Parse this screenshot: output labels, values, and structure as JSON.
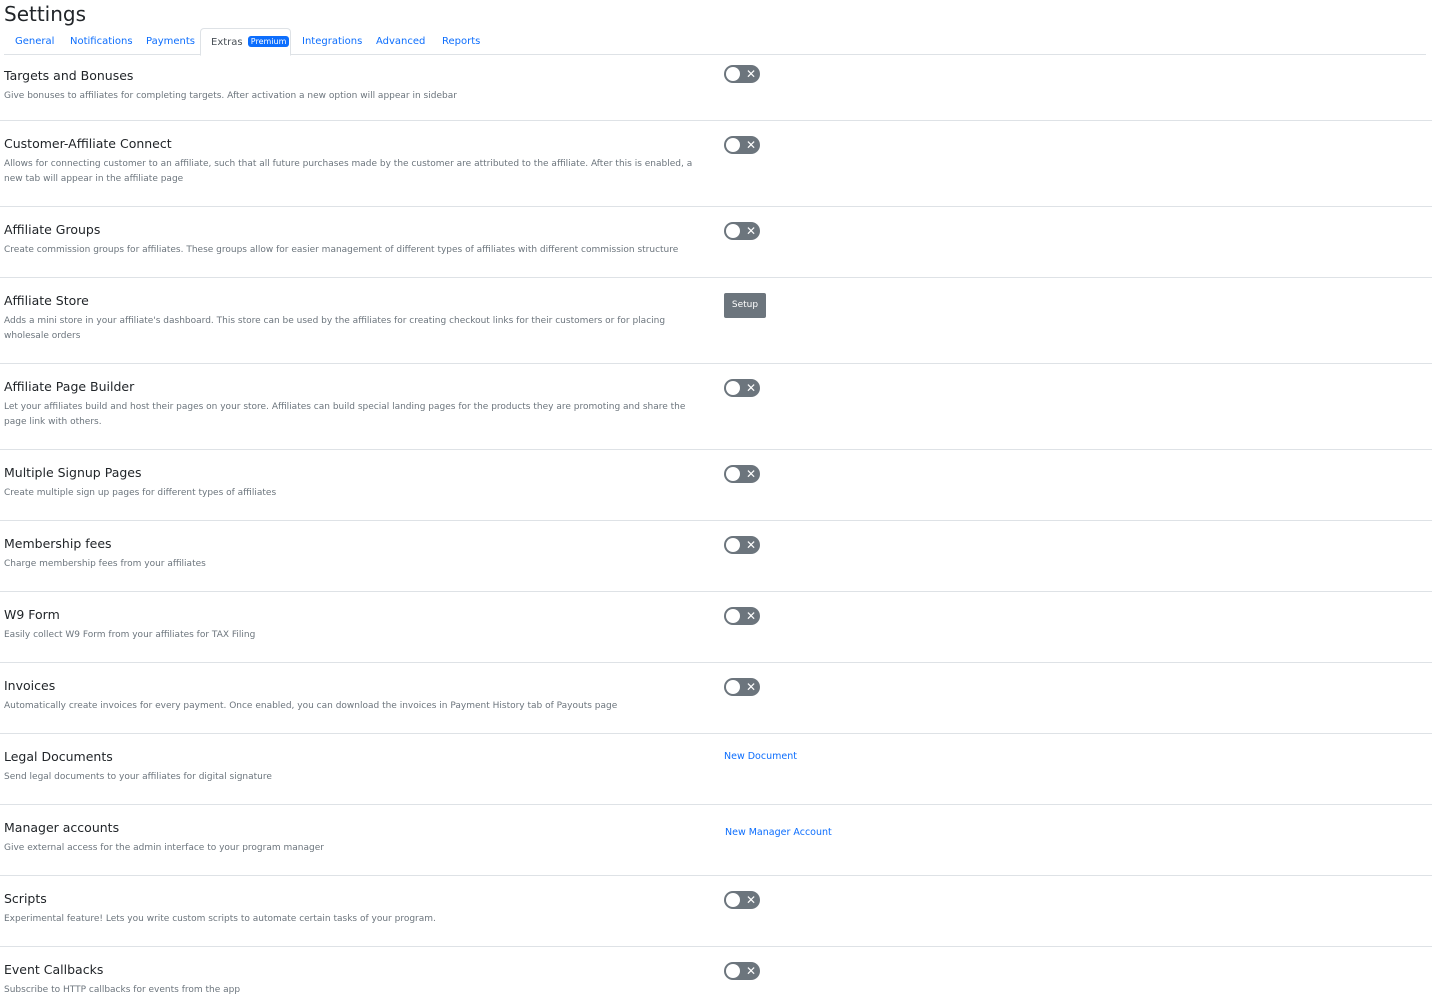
{
  "page": {
    "title": "Settings"
  },
  "tabs": [
    {
      "label": "General"
    },
    {
      "label": "Notifications"
    },
    {
      "label": "Payments"
    },
    {
      "label": "Extras",
      "badge": "Premium",
      "active": true
    },
    {
      "label": "Integrations"
    },
    {
      "label": "Advanced"
    },
    {
      "label": "Reports"
    }
  ],
  "features": [
    {
      "title": "Targets and Bonuses",
      "description": "Give bonuses to affiliates for completing targets. After activation a new option will appear in sidebar",
      "control": "toggle",
      "enabled": false
    },
    {
      "title": "Customer-Affiliate Connect",
      "description": "Allows for connecting customer to an affiliate, such that all future purchases made by the customer are attributed to the affiliate. After this is enabled, a new tab will appear in the affiliate page",
      "control": "toggle",
      "enabled": false
    },
    {
      "title": "Affiliate Groups",
      "description": "Create commission groups for affiliates. These groups allow for easier management of different types of affiliates with different commission structure",
      "control": "toggle",
      "enabled": false
    },
    {
      "title": "Affiliate Store",
      "description": "Adds a mini store in your affiliate's dashboard. This store can be used by the affiliates for creating checkout links for their customers or for placing wholesale orders",
      "control": "button",
      "action_label": "Setup"
    },
    {
      "title": "Affiliate Page Builder",
      "description": "Let your affiliates build and host their pages on your store. Affiliates can build special landing pages for the products they are promoting and share the page link with others.",
      "control": "toggle",
      "enabled": false
    },
    {
      "title": "Multiple Signup Pages",
      "description": "Create multiple sign up pages for different types of affiliates",
      "control": "toggle",
      "enabled": false
    },
    {
      "title": "Membership fees",
      "description": "Charge membership fees from your affiliates",
      "control": "toggle",
      "enabled": false
    },
    {
      "title": "W9 Form",
      "description": "Easily collect W9 Form from your affiliates for TAX Filing",
      "control": "toggle",
      "enabled": false
    },
    {
      "title": "Invoices",
      "description": "Automatically create invoices for every payment. Once enabled, you can download the invoices in Payment History tab of Payouts page",
      "control": "toggle",
      "enabled": false
    },
    {
      "title": "Legal Documents",
      "description": "Send legal documents to your affiliates for digital signature",
      "control": "link",
      "action_label": "New Document"
    },
    {
      "title": "Manager accounts",
      "description": "Give external access for the admin interface to your program manager",
      "control": "link",
      "action_label": "New Manager Account"
    },
    {
      "title": "Scripts",
      "description": "Experimental feature! Lets you write custom scripts to automate certain tasks of your program.",
      "control": "toggle",
      "enabled": false
    },
    {
      "title": "Event Callbacks",
      "description": "Subscribe to HTTP callbacks for events from the app",
      "control": "toggle",
      "enabled": false
    }
  ],
  "icons": {
    "toggle_off": "close-icon"
  },
  "colors": {
    "link": "#0d6efd",
    "toggle_off": "#6c757d",
    "badge": "#0d6efd"
  }
}
